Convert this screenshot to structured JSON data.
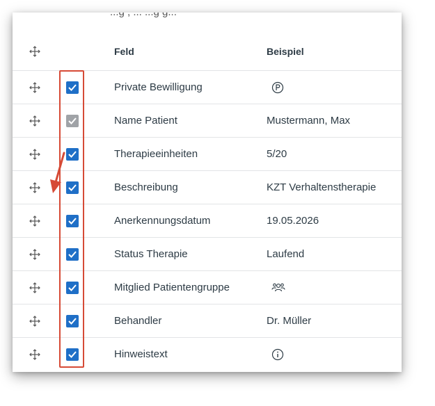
{
  "partial_top_text": "...g ,  ...  ...g  g...",
  "table": {
    "header": {
      "field": "Feld",
      "example": "Beispiel"
    },
    "rows": [
      {
        "field": "Private Bewilligung",
        "example": "",
        "example_icon": "private-p-icon",
        "checked": true,
        "disabled": false
      },
      {
        "field": "Name Patient",
        "example": "Mustermann, Max",
        "example_icon": "",
        "checked": true,
        "disabled": true
      },
      {
        "field": "Therapieeinheiten",
        "example": "5/20",
        "example_icon": "",
        "checked": true,
        "disabled": false
      },
      {
        "field": "Beschreibung",
        "example": "KZT Verhaltenstherapie",
        "example_icon": "",
        "checked": true,
        "disabled": false
      },
      {
        "field": "Anerkennungsdatum",
        "example": "19.05.2026",
        "example_icon": "",
        "checked": true,
        "disabled": false
      },
      {
        "field": "Status Therapie",
        "example": "Laufend",
        "example_icon": "",
        "checked": true,
        "disabled": false
      },
      {
        "field": "Mitglied Patientengruppe",
        "example": "",
        "example_icon": "group-icon",
        "checked": true,
        "disabled": false
      },
      {
        "field": "Behandler",
        "example": "Dr. Müller",
        "example_icon": "",
        "checked": true,
        "disabled": false
      },
      {
        "field": "Hinweistext",
        "example": "",
        "example_icon": "info-icon",
        "checked": true,
        "disabled": false
      }
    ]
  },
  "colors": {
    "checkbox_checked": "#1f6fc7",
    "checkbox_disabled": "#a0a3a7",
    "annotation_red": "#d64a36",
    "text": "#2d3b45"
  }
}
